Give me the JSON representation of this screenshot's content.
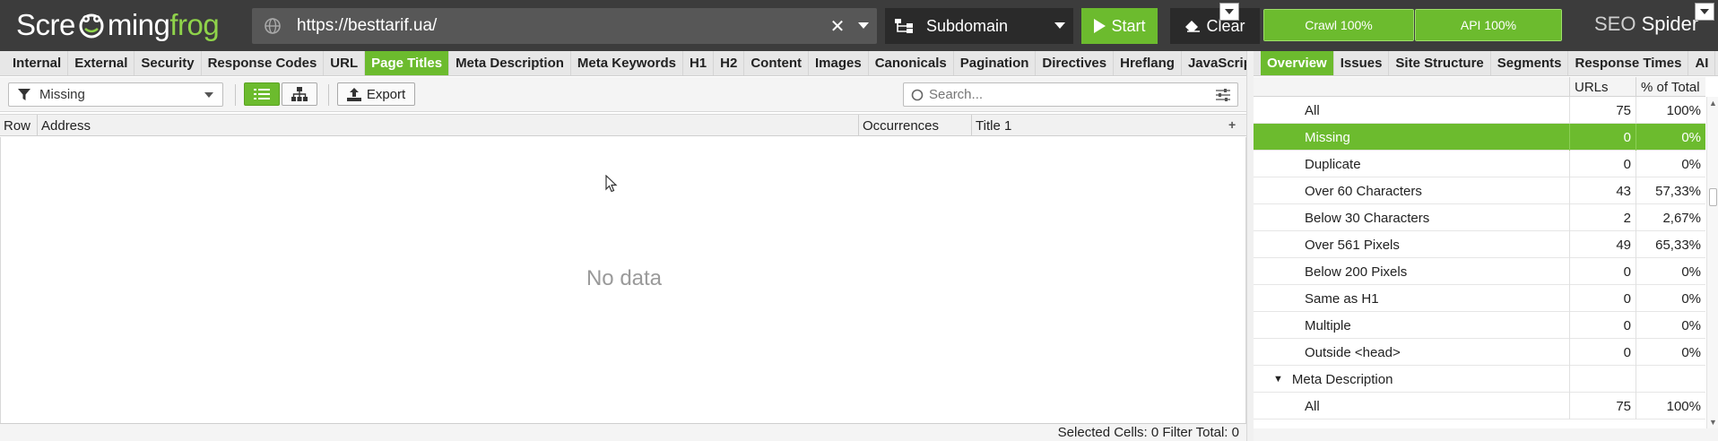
{
  "app": {
    "logo_part1": "Scre",
    "logo_part2": "ming",
    "logo_part3": "frog",
    "product_seo": "SEO",
    "product_spider": "Spider"
  },
  "topbar": {
    "url": "https://besttarif.ua/",
    "clear_url_icon": "close-icon",
    "mode": "Subdomain",
    "start_label": "Start",
    "clear_label": "Clear",
    "crawl_progress_label": "Crawl 100%",
    "crawl_progress": 1.0,
    "api_progress_label": "API 100%",
    "api_progress": 1.0
  },
  "left_tabs": [
    "Internal",
    "External",
    "Security",
    "Response Codes",
    "URL",
    "Page Titles",
    "Meta Description",
    "Meta Keywords",
    "H1",
    "H2",
    "Content",
    "Images",
    "Canonicals",
    "Pagination",
    "Directives",
    "Hreflang",
    "JavaScrip"
  ],
  "left_active_tab": "Page Titles",
  "right_tabs": [
    "Overview",
    "Issues",
    "Site Structure",
    "Segments",
    "Response Times",
    "AI"
  ],
  "right_active_tab": "Overview",
  "toolbar": {
    "filter_value": "Missing",
    "export_label": "Export",
    "search_placeholder": "Search..."
  },
  "table": {
    "columns": [
      "Row",
      "Address",
      "Occurrences",
      "Title 1"
    ],
    "empty_text": "No data"
  },
  "status": {
    "text": "Selected Cells:  0  Filter Total:  0"
  },
  "overview": {
    "col_urls": "URLs",
    "col_pct": "% of Total",
    "rows": [
      {
        "label": "All",
        "urls": "75",
        "pct": "100%",
        "selected": false,
        "section": false
      },
      {
        "label": "Missing",
        "urls": "0",
        "pct": "0%",
        "selected": true,
        "section": false
      },
      {
        "label": "Duplicate",
        "urls": "0",
        "pct": "0%",
        "selected": false,
        "section": false
      },
      {
        "label": "Over 60 Characters",
        "urls": "43",
        "pct": "57,33%",
        "selected": false,
        "section": false
      },
      {
        "label": "Below 30 Characters",
        "urls": "2",
        "pct": "2,67%",
        "selected": false,
        "section": false
      },
      {
        "label": "Over 561 Pixels",
        "urls": "49",
        "pct": "65,33%",
        "selected": false,
        "section": false
      },
      {
        "label": "Below 200 Pixels",
        "urls": "0",
        "pct": "0%",
        "selected": false,
        "section": false
      },
      {
        "label": "Same as H1",
        "urls": "0",
        "pct": "0%",
        "selected": false,
        "section": false
      },
      {
        "label": "Multiple",
        "urls": "0",
        "pct": "0%",
        "selected": false,
        "section": false
      },
      {
        "label": "Outside <head>",
        "urls": "0",
        "pct": "0%",
        "selected": false,
        "section": false
      },
      {
        "label": "Meta Description",
        "urls": "",
        "pct": "",
        "selected": false,
        "section": true
      },
      {
        "label": "All",
        "urls": "75",
        "pct": "100%",
        "selected": false,
        "section": false
      }
    ]
  },
  "colors": {
    "accent_green": "#6cbb2e",
    "topbar_bg": "#3c3c3c"
  }
}
